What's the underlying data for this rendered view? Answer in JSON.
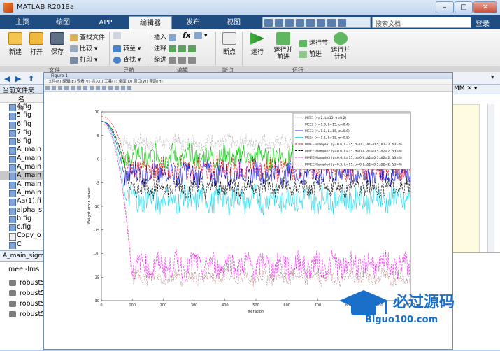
{
  "window": {
    "title": "MATLAB R2018a",
    "min": "–",
    "max": "□",
    "close": "✕"
  },
  "tabs": [
    {
      "label": "主页"
    },
    {
      "label": "绘图"
    },
    {
      "label": "APP"
    },
    {
      "label": "编辑器"
    },
    {
      "label": "发布"
    },
    {
      "label": "视图"
    }
  ],
  "search": {
    "placeholder": "搜索文档"
  },
  "login_label": "登录",
  "ribbon": {
    "file": {
      "new": "新建",
      "open": "打开",
      "save": "保存",
      "find_files": "查找文件",
      "compare": "比较",
      "print": "打印"
    },
    "navigate": {
      "goto": "转至",
      "find": "查找"
    },
    "edit": {
      "insert": "插入",
      "comment": "注释",
      "indent": "缩进",
      "fx": "fx"
    },
    "breakpoints": {
      "label": "断点"
    },
    "run": {
      "run": "运行",
      "run_advance": "运行并\n前进",
      "run_section": "运行节",
      "advance": "前进",
      "run_time": "运行并\n计时"
    },
    "groups": {
      "file": "文件",
      "navigate": "导航",
      "edit": "编辑",
      "breakpoints": "断点",
      "run": "运行"
    }
  },
  "current_folder": {
    "title": "当前文件夹",
    "col_name": "名称",
    "files": [
      {
        "name": "4.fig",
        "type": "fig"
      },
      {
        "name": "5.fig",
        "type": "fig"
      },
      {
        "name": "6.fig",
        "type": "fig"
      },
      {
        "name": "7.fig",
        "type": "fig"
      },
      {
        "name": "8.fig",
        "type": "fig"
      },
      {
        "name": "A_main",
        "type": "fig"
      },
      {
        "name": "A_main",
        "type": "fig"
      },
      {
        "name": "A_main",
        "type": "fig"
      },
      {
        "name": "A_main",
        "type": "fig",
        "selected": true
      },
      {
        "name": "A_main",
        "type": "fig"
      },
      {
        "name": "A_main",
        "type": "fig"
      },
      {
        "name": "Aa(1).fi",
        "type": "fig"
      },
      {
        "name": "alpha_s",
        "type": "fig"
      },
      {
        "name": "b.fig",
        "type": "fig"
      },
      {
        "name": "c.fig",
        "type": "fig"
      },
      {
        "name": "Copy_o",
        "type": "m"
      },
      {
        "name": "C",
        "type": "fig"
      }
    ]
  },
  "details": {
    "label": "A_main_sigm"
  },
  "workspace": {
    "header": "mee -lms",
    "items": [
      {
        "name": "robust5"
      },
      {
        "name": "robust5"
      },
      {
        "name": "robust5"
      },
      {
        "name": "robust5"
      }
    ]
  },
  "editor_tab": {
    "label": "MM"
  },
  "figure": {
    "title": "Figure 1",
    "menu": "文件(F)  编辑(E)  查看(V)  插入(I)  工具(T)  桌面(D)  窗口(W)  帮助(H)"
  },
  "chart_data": {
    "type": "line",
    "xlabel": "Iteration",
    "ylabel": "Weight error power",
    "xlim": [
      0,
      1000
    ],
    "ylim": [
      -30,
      10
    ],
    "xticks": [
      "0",
      "100",
      "200",
      "300",
      "400",
      "500",
      "600",
      "700",
      "800",
      "900",
      "1000"
    ],
    "yticks": [
      "10",
      "5",
      "0",
      "-5",
      "-10",
      "-15",
      "-20",
      "-25",
      "-30"
    ],
    "legend_position": "top-right",
    "series": [
      {
        "name": "MEE1 (γ=2, L=15, σ=0.2)",
        "color": "#a8a8a8",
        "style": "dotted",
        "start": 8,
        "steady": 3.5,
        "amp": 1.5
      },
      {
        "name": "MEE2 (γ=1.8, L=15, σ=0.4)",
        "color": "#00cc00",
        "style": "solid",
        "start": 8,
        "steady": 0.5,
        "amp": 2.2
      },
      {
        "name": "MEE3 (γ=1.5, L=15, σ=0.6)",
        "color": "#1010dd",
        "style": "solid",
        "start": 8,
        "steady": -3,
        "amp": 2.3
      },
      {
        "name": "MEE4 (γ=1.1, L=15, σ=0.8)",
        "color": "#22ddee",
        "style": "solid",
        "start": 8,
        "steady": -8.5,
        "amp": 2.5
      },
      {
        "name": "MMEE-Hample1 (γ=0.6, L=15, σ=0.2, Δ1=0.5, Δ2=2, Δ3=4)",
        "color": "#dd1010",
        "style": "dashed",
        "start": 9,
        "steady": -2,
        "amp": 2.2
      },
      {
        "name": "MMEE-Hample2 (γ=0.6, L=15, σ=0.4, Δ1=0.5, Δ2=2, Δ3=4)",
        "color": "#000000",
        "style": "dashed",
        "start": 8,
        "steady": -6,
        "amp": 1.8
      },
      {
        "name": "MMEE-Hample3 (γ=0.6, L=15, σ=0.6, Δ1=0.5, Δ2=2, Δ3=4)",
        "color": "#ee22ee",
        "style": "dashed",
        "start": 8,
        "steady": -22.5,
        "amp": 2.5
      },
      {
        "name": "MMEE-Hample4 (γ=0.3, L=15, σ=0.8, Δ1=0.5, Δ2=2, Δ3=4)",
        "color": "#b07070",
        "style": "dotted",
        "start": 7.5,
        "steady": -25,
        "amp": 1.5
      }
    ]
  },
  "watermark": {
    "text": "必过源码",
    "sub": "Biguo100.com"
  }
}
